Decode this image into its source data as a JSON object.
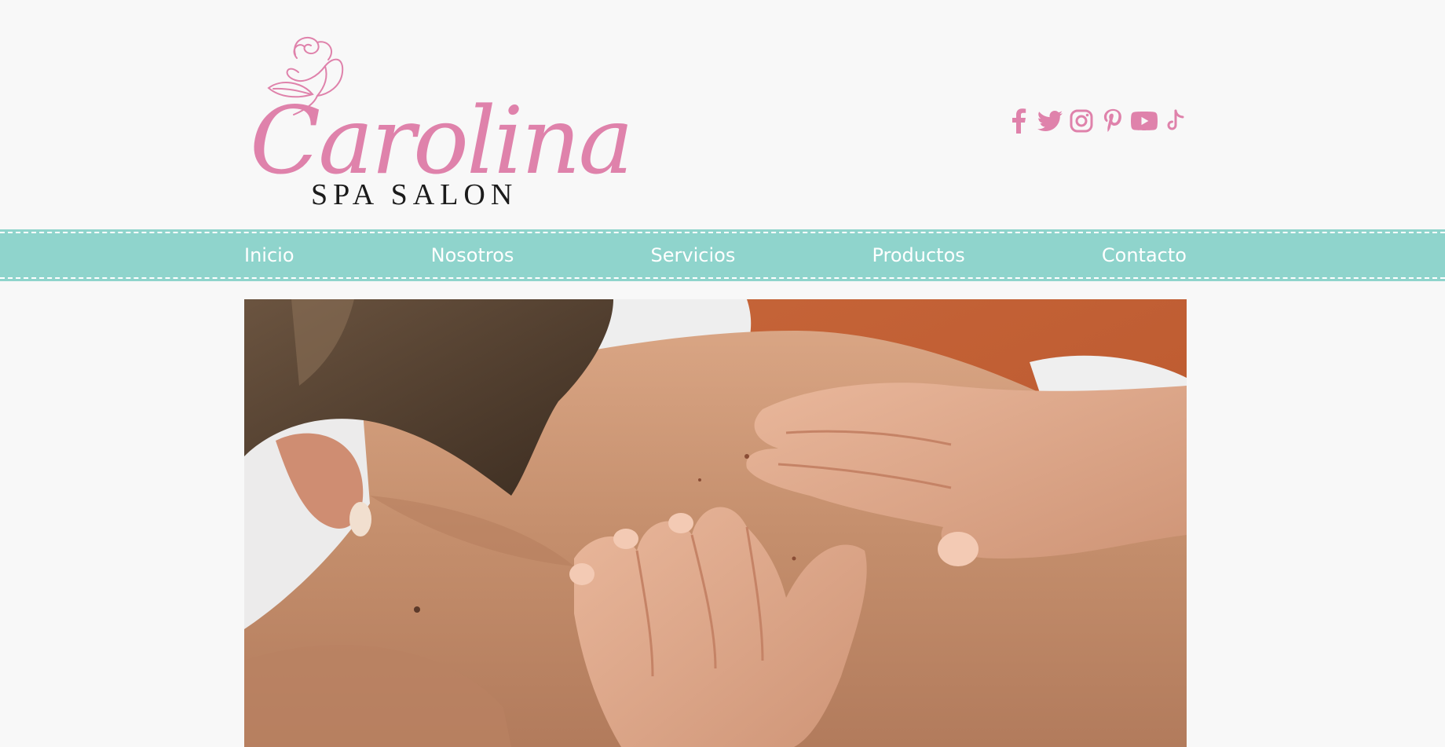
{
  "brand": {
    "script_name": "Carolina",
    "subtitle": "SPA SALON",
    "accent_pink": "#df82ab",
    "teal": "#8fd4cc"
  },
  "social": [
    {
      "name": "facebook-icon"
    },
    {
      "name": "twitter-icon"
    },
    {
      "name": "instagram-icon"
    },
    {
      "name": "pinterest-icon"
    },
    {
      "name": "youtube-icon"
    },
    {
      "name": "tiktok-icon"
    }
  ],
  "nav": {
    "items": [
      {
        "label": "Inicio"
      },
      {
        "label": "Nosotros"
      },
      {
        "label": "Servicios"
      },
      {
        "label": "Productos"
      },
      {
        "label": "Contacto"
      }
    ]
  },
  "hero": {
    "image_alt": "massage-photo"
  }
}
